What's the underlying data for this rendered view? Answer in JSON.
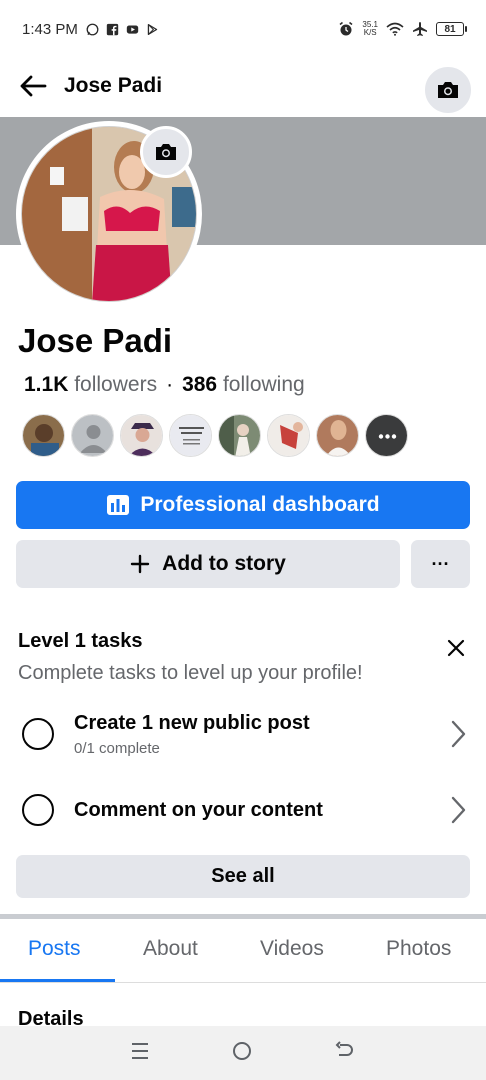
{
  "status_bar": {
    "time": "1:43 PM",
    "speed_value": "35.1",
    "speed_unit": "K/S",
    "battery": "81",
    "app_icons": [
      "whatsapp-icon",
      "facebook-icon",
      "youtube-icon",
      "play-store-icon"
    ],
    "system_icons": [
      "alarm-icon",
      "wifi-icon",
      "airplane-icon",
      "battery-icon"
    ]
  },
  "header": {
    "title": "Jose Padi"
  },
  "profile": {
    "name": "Jose Padi",
    "followers_count": "1.1K",
    "followers_label": "followers",
    "separator": "·",
    "following_count": "386",
    "following_label": "following",
    "friend_avatars": [
      {
        "color": "#8a6d4b"
      },
      {
        "color": "#bcc0c4"
      },
      {
        "color": "#6b5a7a"
      },
      {
        "color": "#e9eaf0"
      },
      {
        "color": "#7d8b74"
      },
      {
        "color": "#c7423c"
      },
      {
        "color": "#b07a5d"
      }
    ]
  },
  "actions": {
    "professional_dashboard": "Professional dashboard",
    "add_to_story": "Add to story",
    "more": "···"
  },
  "tasks": {
    "title": "Level 1 tasks",
    "subtitle": "Complete tasks to level up your profile!",
    "items": [
      {
        "label": "Create 1 new public post",
        "progress": "0/1 complete"
      },
      {
        "label": "Comment on your content",
        "progress": ""
      }
    ],
    "see_all": "See all"
  },
  "tabs": [
    {
      "label": "Posts",
      "active": true
    },
    {
      "label": "About",
      "active": false
    },
    {
      "label": "Videos",
      "active": false
    },
    {
      "label": "Photos",
      "active": false
    }
  ],
  "details_heading": "Details",
  "colors": {
    "accent": "#1877f2",
    "button_gray": "#e4e6eb",
    "secondary_text": "#65676b",
    "cover": "#a3a6a9"
  }
}
